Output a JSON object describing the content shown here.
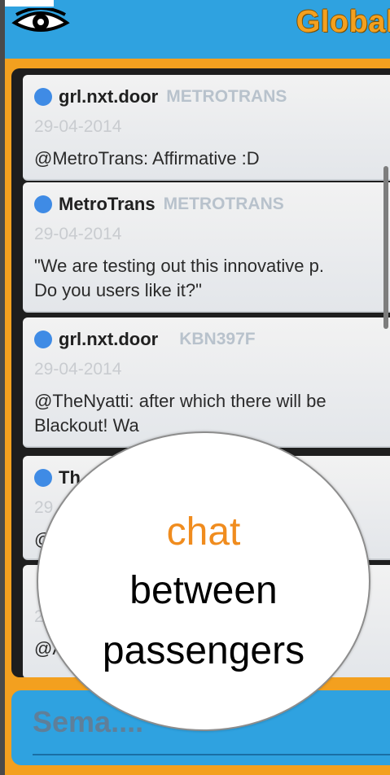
{
  "header": {
    "title": "Global",
    "eye_icon": "eye-icon"
  },
  "messages": [
    {
      "user": "grl.nxt.door",
      "route": "METROTRANS",
      "date": "29-04-2014",
      "text": "@MetroTrans: Affirmative :D"
    },
    {
      "user": "MetroTrans",
      "route": "METROTRANS",
      "date": "29-04-2014",
      "text": "\"We are testing out this innovative p.\nDo you users like it?\""
    },
    {
      "user": "grl.nxt.door",
      "route": "KBN397F",
      "date": "29-04-2014",
      "text": "@TheNyatti: after which there will be\nBlackout! Wa"
    },
    {
      "user": "Th",
      "route": "",
      "date": "29",
      "text": "@"
    },
    {
      "user": "",
      "route": "",
      "date": "2",
      "text": "@A"
    }
  ],
  "input": {
    "placeholder": "Sema...."
  },
  "callout": {
    "line1": "chat",
    "line2": "between",
    "line3": "passengers"
  },
  "colors": {
    "accent_orange": "#f3a01f",
    "header_blue": "#2fa2e0",
    "avatar_dot": "#3f8be5"
  }
}
